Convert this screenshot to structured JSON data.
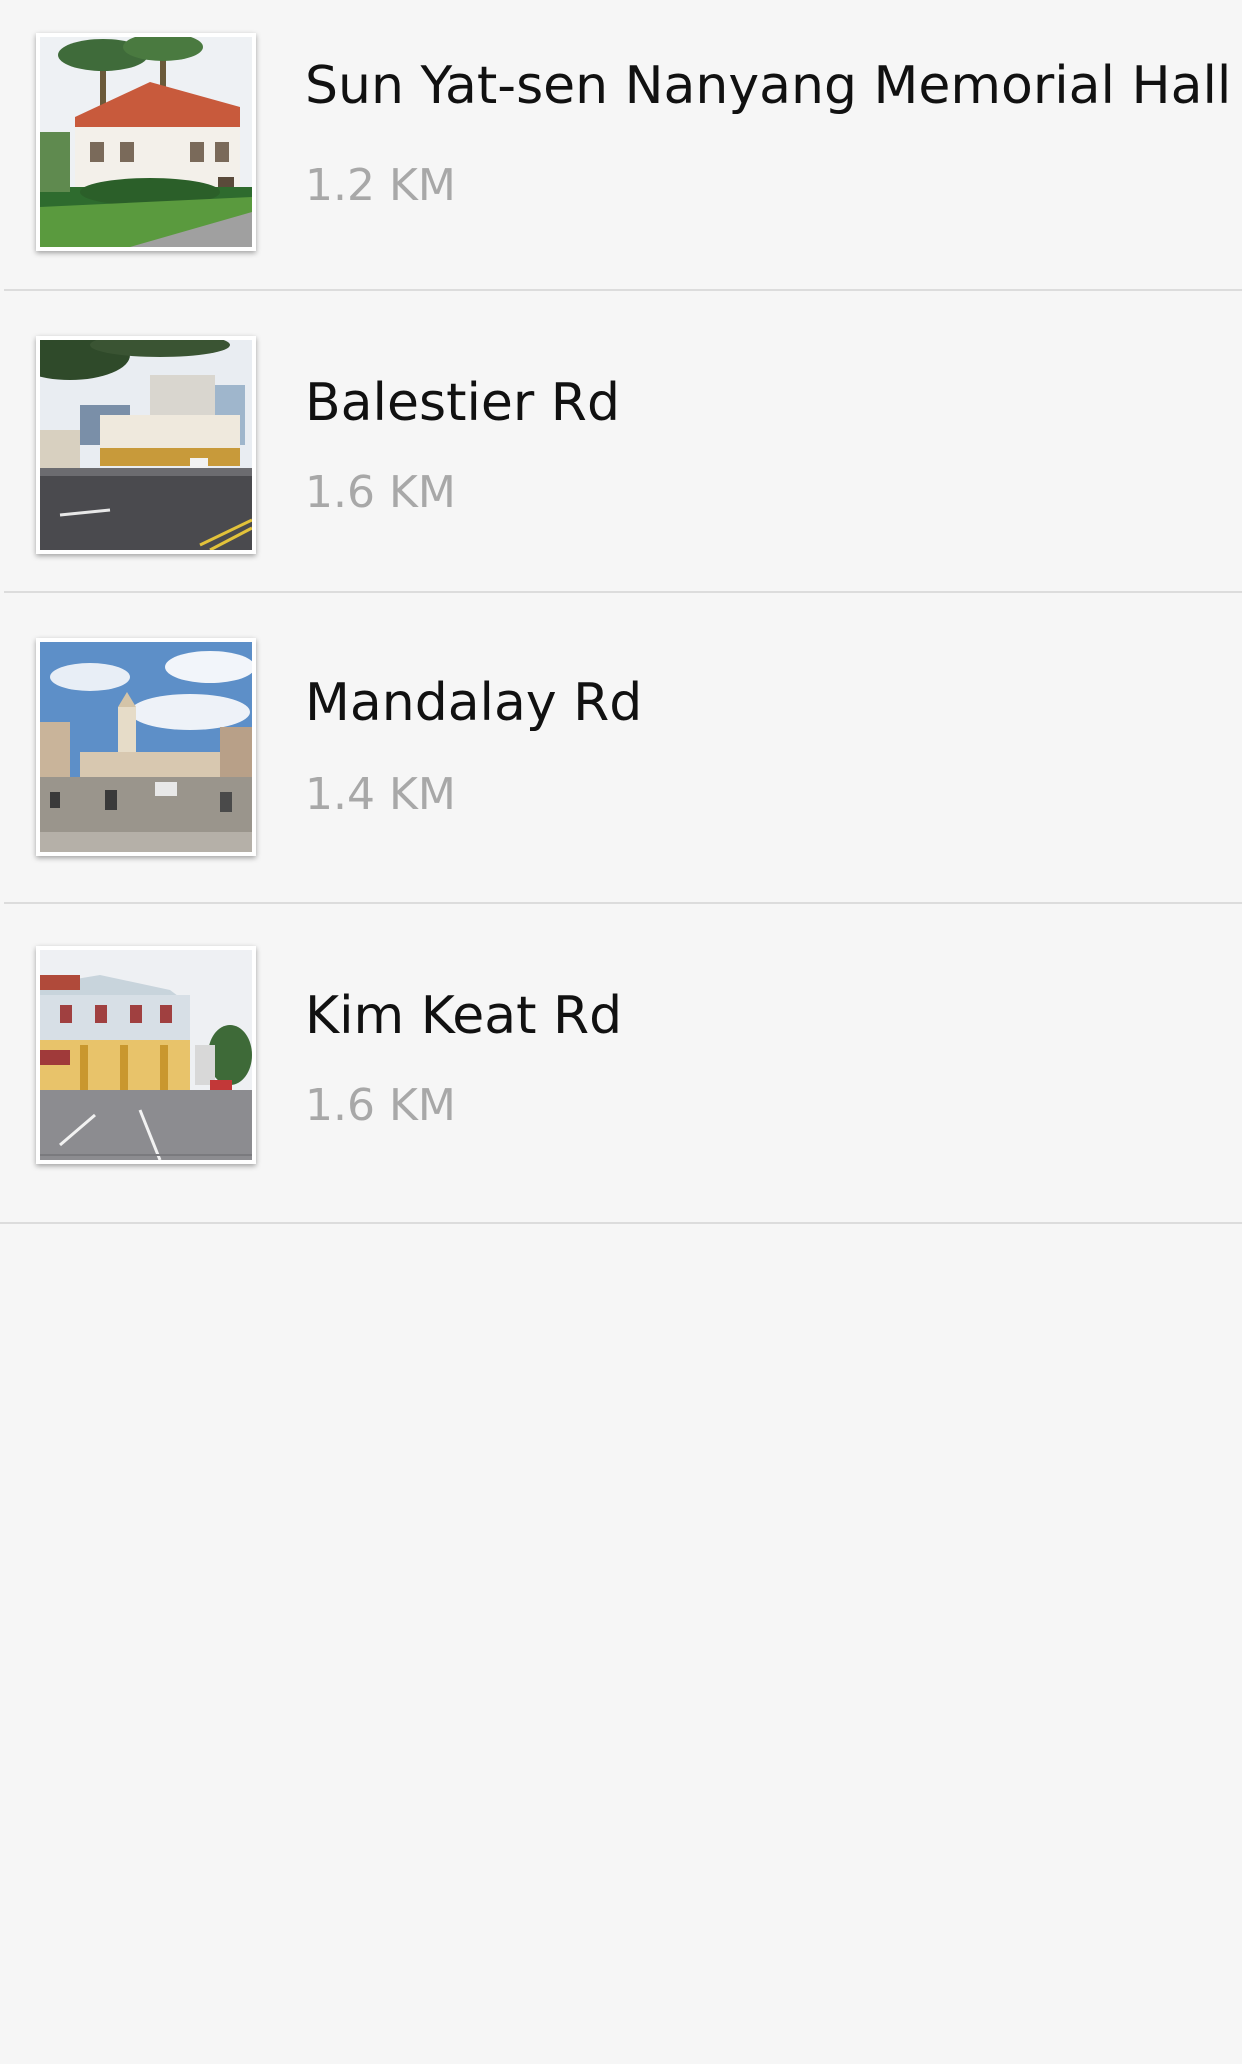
{
  "places": [
    {
      "name": "Sun Yat-sen Nanyang Memorial Hall",
      "distance": "1.2 KM",
      "thumbnail": "memorial-hall-photo"
    },
    {
      "name": "Balestier Rd",
      "distance": "1.6 KM",
      "thumbnail": "balestier-road-photo"
    },
    {
      "name": "Mandalay Rd",
      "distance": "1.4 KM",
      "thumbnail": "mandalay-road-photo"
    },
    {
      "name": "Kim Keat Rd",
      "distance": "1.6 KM",
      "thumbnail": "kim-keat-road-photo"
    }
  ],
  "colors": {
    "background": "#f6f6f6",
    "title": "#111111",
    "distance": "#a8a8a8",
    "divider": "#dcdcdc"
  }
}
